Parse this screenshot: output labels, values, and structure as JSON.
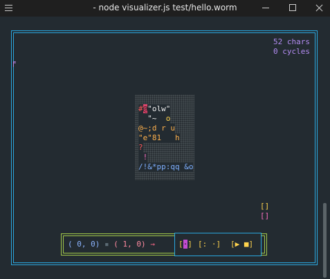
{
  "window": {
    "title": "- node visualizer.js test/hello.worm"
  },
  "stats": {
    "chars": "52 chars",
    "cycles": "0 cycles"
  },
  "edge_mark": "╒",
  "code": {
    "lines": [
      {
        "parts": [
          {
            "text": "#",
            "cls": "c-red"
          },
          {
            "text": "@",
            "cls": "c-cursor"
          },
          {
            "text": "\"olw\"",
            "cls": "c-white"
          }
        ]
      },
      {
        "parts": [
          {
            "text": "  \"~  ",
            "cls": "c-white"
          },
          {
            "text": "o",
            "cls": "c-yellow"
          }
        ]
      },
      {
        "parts": [
          {
            "text": "@~;d r u",
            "cls": "c-orange"
          }
        ]
      },
      {
        "parts": [
          {
            "text": "\"e\"81   h",
            "cls": "c-orange"
          }
        ]
      },
      {
        "parts": [
          {
            "text": "?",
            "cls": "c-red"
          }
        ]
      },
      {
        "parts": [
          {
            "text": " !",
            "cls": "c-pink"
          }
        ]
      },
      {
        "parts": [
          {
            "text": "/!&*pp:qq &o",
            "cls": "c-blue"
          }
        ]
      }
    ]
  },
  "brackets": {
    "top": "[]",
    "bottom": "[]"
  },
  "controls": {
    "from": "( 0, 0)",
    "separator": "▪",
    "to": "( 1, 0)",
    "arrow": "→",
    "step_label_left": "[",
    "step_label_mid": "·",
    "step_label_right": "]",
    "pause_label": "[: ·]",
    "play_label": "[▶ ■]"
  },
  "colors": {
    "frame": "#2aa8e0",
    "stats": "#b38cf2",
    "accent_green": "#a3c94a"
  }
}
